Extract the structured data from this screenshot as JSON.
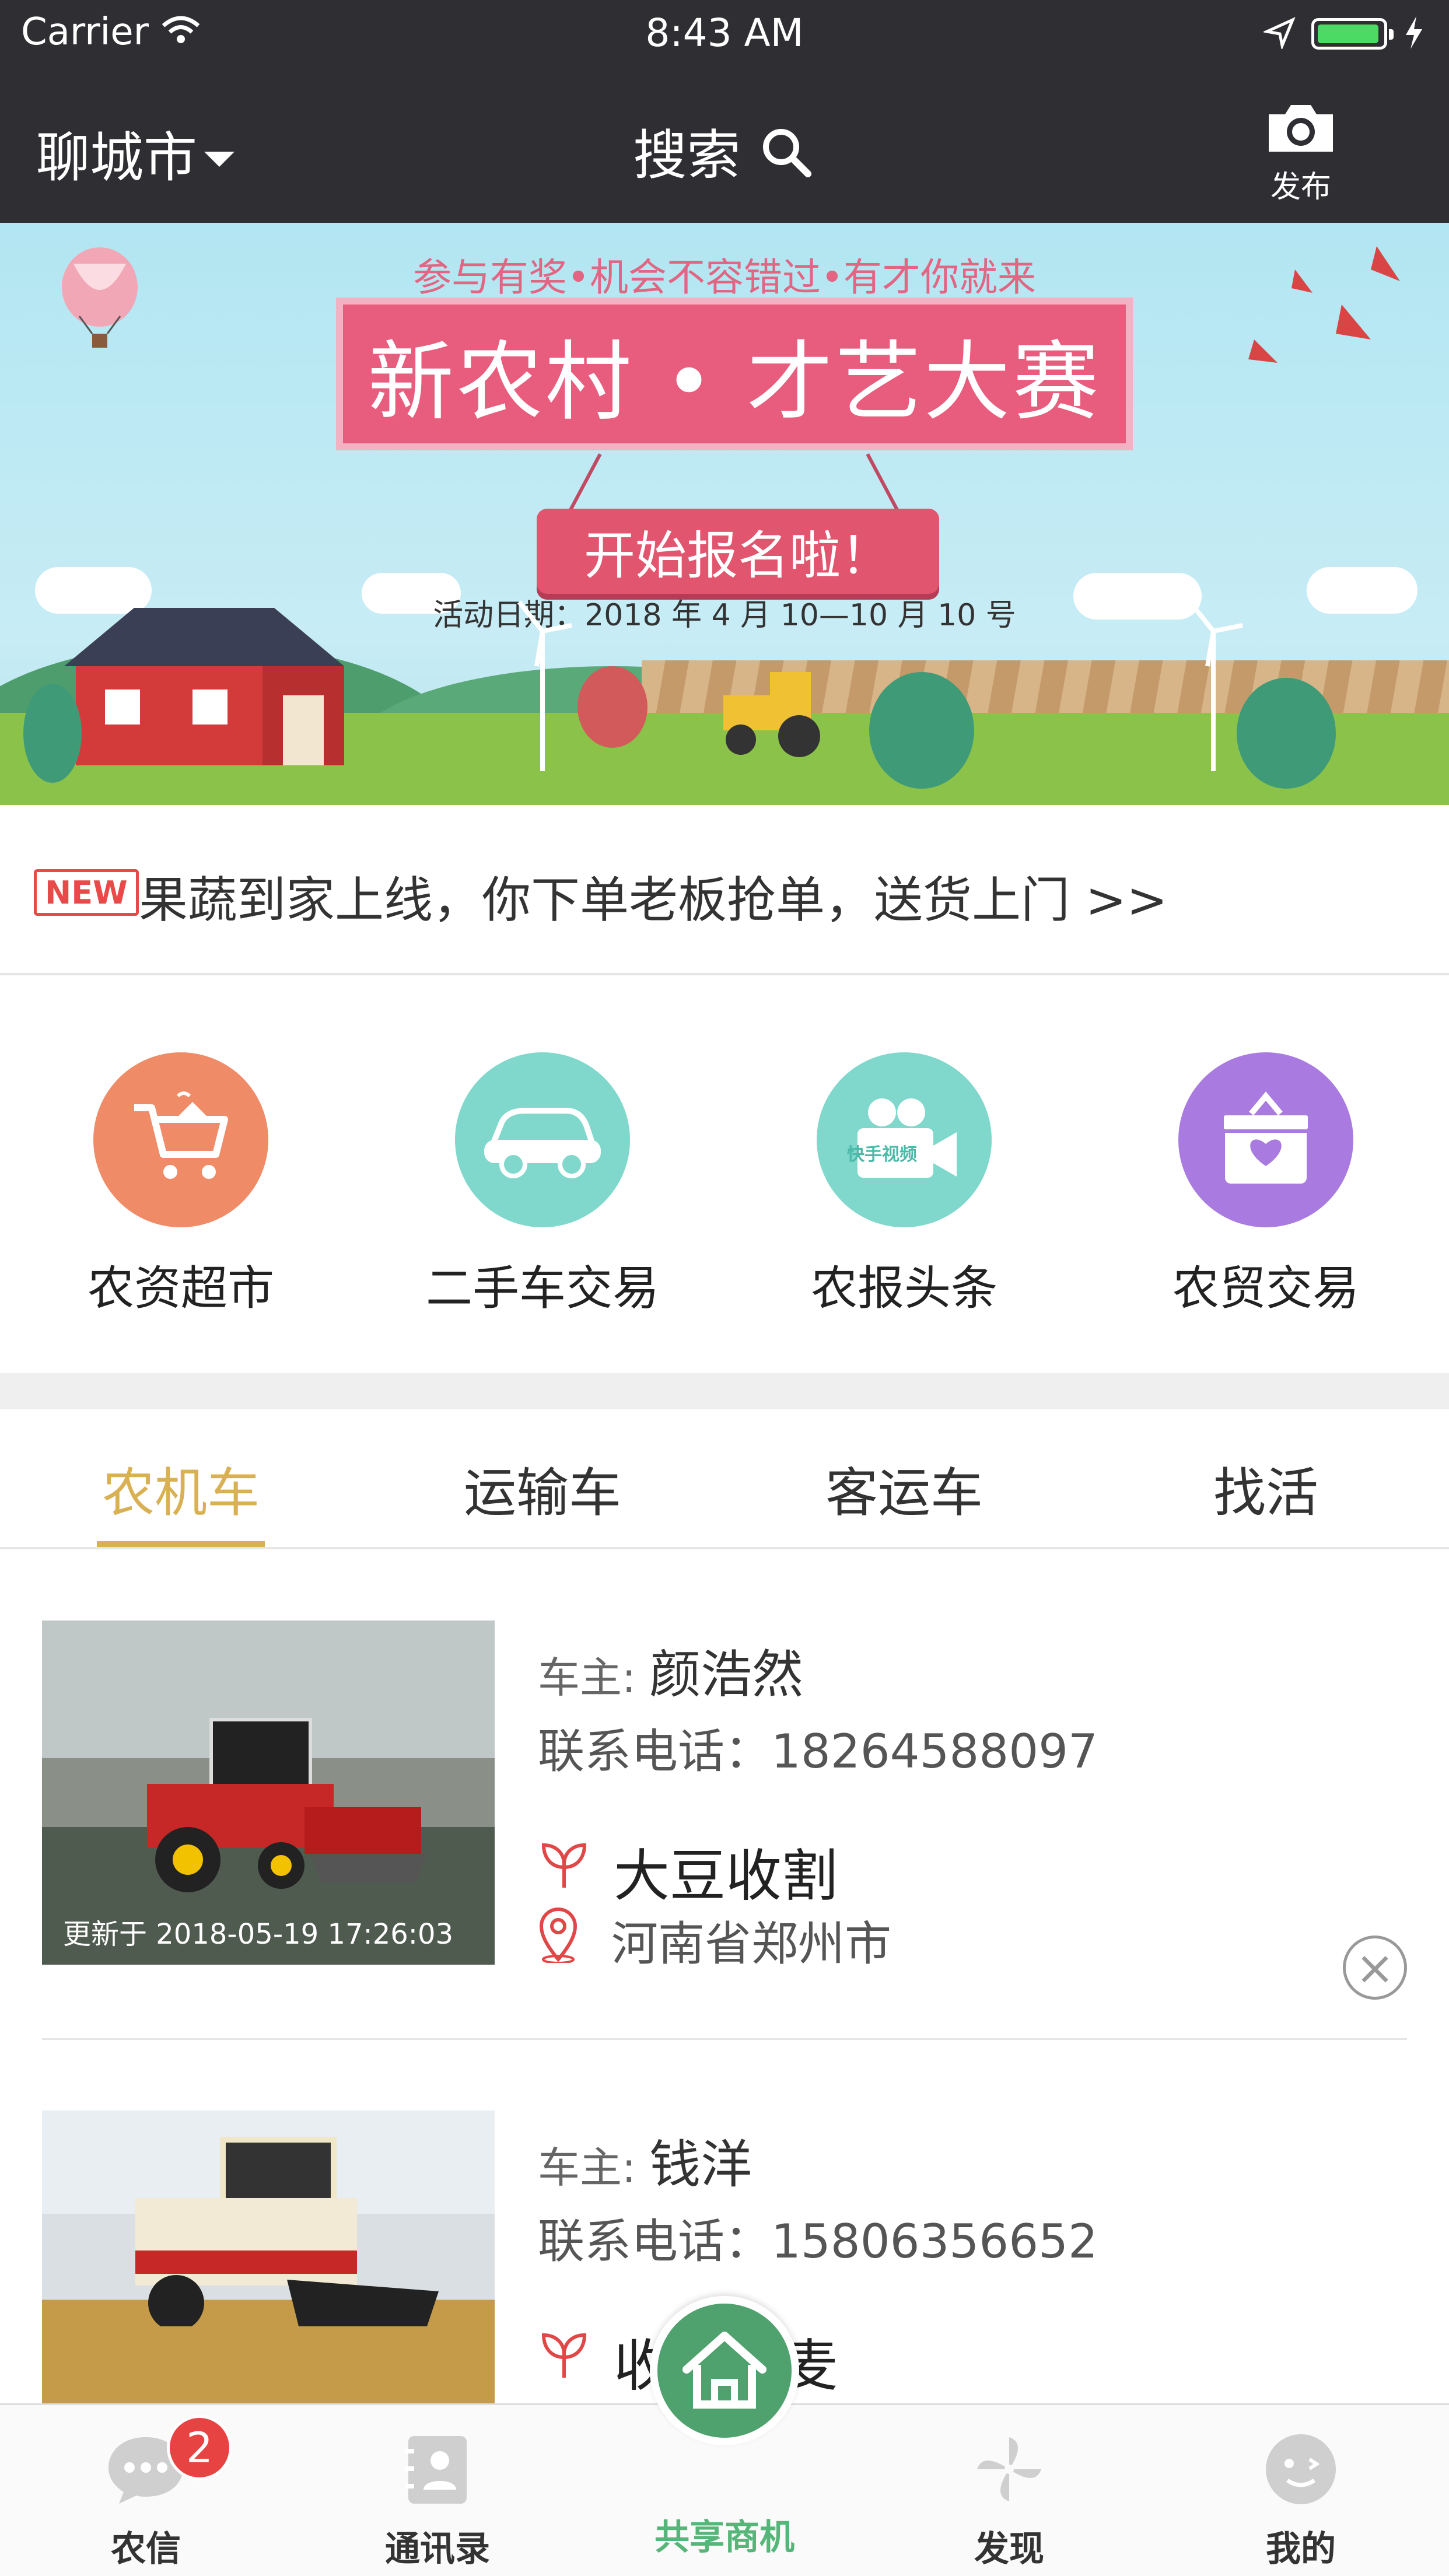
{
  "status": {
    "carrier": "Carrier",
    "time": "8:43 AM"
  },
  "nav": {
    "city": "聊城市",
    "search": "搜索",
    "publish": "发布"
  },
  "banner": {
    "subtitle": "参与有奖•机会不容错过•有才你就来",
    "title": "新农村 • 才艺大赛",
    "tag": "开始报名啦！",
    "date": "活动日期：2018 年 4 月 10—10 月 10 号"
  },
  "news": {
    "badge": "NEW",
    "text": "果蔬到家上线，你下单老板抢单，送货上门 >>"
  },
  "categories": [
    {
      "label": "农资超市",
      "color": "#ef8b66"
    },
    {
      "label": "二手车交易",
      "color": "#7fd8cb"
    },
    {
      "label": "农报头条",
      "color": "#7fd8cb",
      "icon_text": "快手视频"
    },
    {
      "label": "农贸交易",
      "color": "#a97be0"
    }
  ],
  "tabs": [
    "农机车",
    "运输车",
    "客运车",
    "找活"
  ],
  "listings": [
    {
      "owner_label": "车主:",
      "owner": "颜浩然",
      "phone_label": "联系电话：",
      "phone": "18264588097",
      "service": "大豆收割",
      "location": "河南省郑州市",
      "updated": "更新于 2018-05-19 17:26:03"
    },
    {
      "owner_label": "车主:",
      "owner": "钱洋",
      "phone_label": "联系电话：",
      "phone": "15806356652",
      "service": "收割小麦"
    }
  ],
  "tabbar": {
    "items": [
      "农信",
      "通讯录",
      "共享商机",
      "发现",
      "我的"
    ],
    "badge": "2",
    "active_color": "#56b67a"
  }
}
